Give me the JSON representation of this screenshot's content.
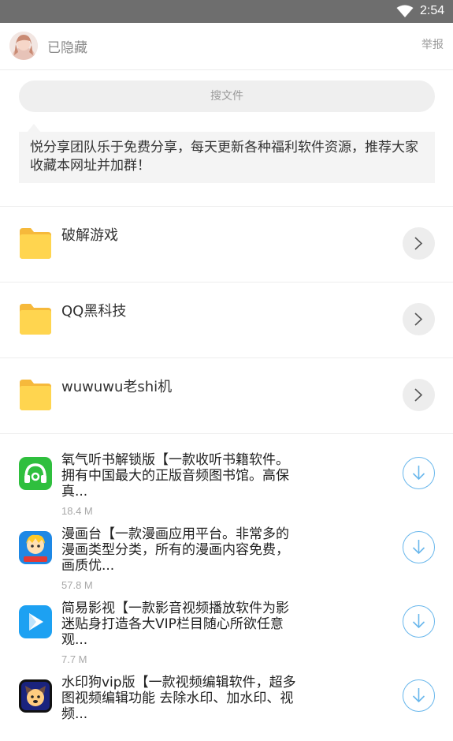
{
  "status_bar": {
    "time": "2:54",
    "wifi_icon": "wifi-icon"
  },
  "header": {
    "username": "已隐藏",
    "report_label": "举报",
    "avatar_icon": "user-avatar"
  },
  "search": {
    "placeholder": "搜文件"
  },
  "notice": {
    "text": "悦分享团队乐于免费分享，每天更新各种福利软件资源，推荐大家收藏本网址并加群！"
  },
  "folders": [
    {
      "name": "破解游戏",
      "icon": "folder-icon"
    },
    {
      "name": "QQ黑科技",
      "icon": "folder-icon"
    },
    {
      "name": "wuwuwu老shi机",
      "icon": "folder-icon"
    }
  ],
  "files": [
    {
      "title": "氧气听书解锁版【一款收听书籍软件。拥有中国最大的正版音频图书馆。高保真...",
      "size": "18.4 M",
      "icon": "headphones-app-icon",
      "color": "#2fbf3e"
    },
    {
      "title": "漫画台【一款漫画应用平台。非常多的漫画类型分类，所有的漫画内容免费，画质优...",
      "size": "57.8 M",
      "icon": "manga-app-icon",
      "color": "#1e88e5"
    },
    {
      "title": "简易影视【一款影音视频播放软件为影迷贴身打造各大VIP栏目随心所欲任意观...",
      "size": "7.7 M",
      "icon": "play-app-icon",
      "color": "#1da1f2"
    },
    {
      "title": "水印狗vip版【一款视频编辑软件，超多图视频编辑功能 去除水印、加水印、视频...",
      "size": "",
      "icon": "watermark-dog-app-icon",
      "color": "#1a237e"
    }
  ]
}
